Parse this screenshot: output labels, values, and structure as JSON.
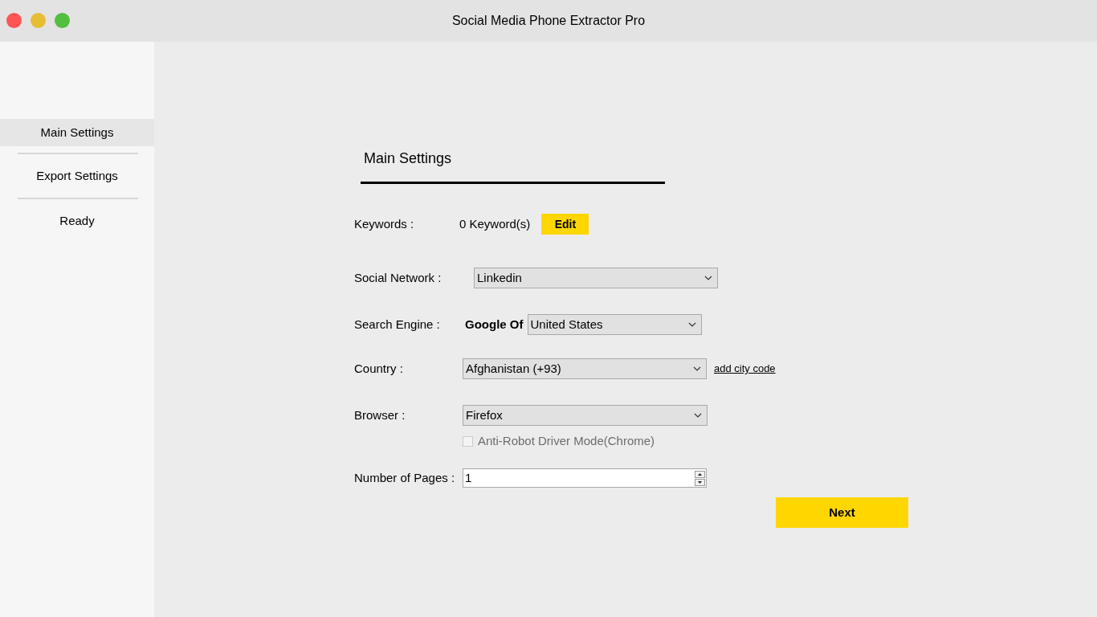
{
  "window": {
    "title": "Social Media Phone Extractor Pro"
  },
  "sidebar": {
    "items": [
      {
        "label": "Main Settings",
        "selected": true
      },
      {
        "label": "Export Settings",
        "selected": false
      },
      {
        "label": "Ready",
        "selected": false
      }
    ]
  },
  "heading": "Main Settings",
  "form": {
    "keywords": {
      "label": "Keywords :",
      "count": "0 Keyword(s)",
      "button": "Edit"
    },
    "social_network": {
      "label": "Social Network :",
      "value": "Linkedin"
    },
    "search_engine": {
      "label": "Search Engine :",
      "prefix": "Google Of",
      "value": "United States"
    },
    "country": {
      "label": "Country :",
      "value": "Afghanistan (+93)",
      "link": "add city code"
    },
    "browser": {
      "label": "Browser :",
      "value": "Firefox"
    },
    "anti_robot": {
      "label": "Anti-Robot Driver Mode(Chrome)",
      "checked": false,
      "disabled": true
    },
    "pages": {
      "label": "Number of Pages :",
      "value": "1"
    }
  },
  "next_button": "Next"
}
